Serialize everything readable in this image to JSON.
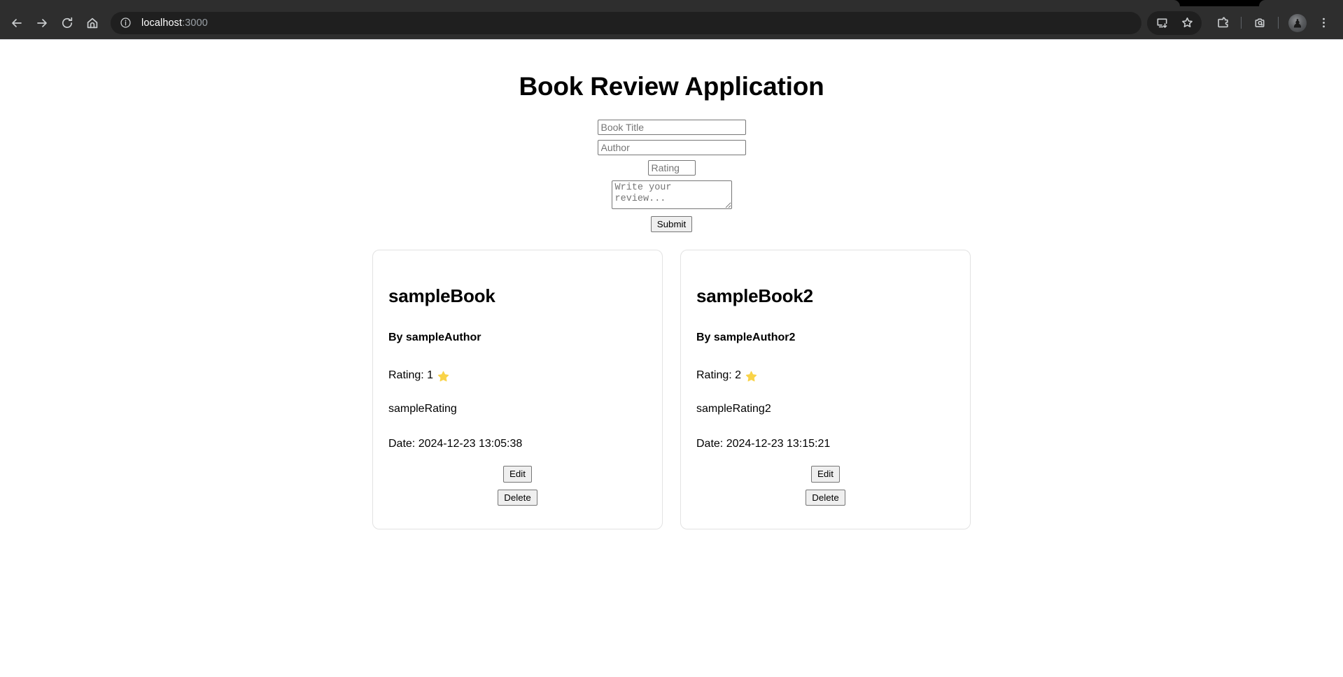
{
  "browser": {
    "nav": {
      "back_label": "Back",
      "forward_label": "Forward",
      "reload_label": "Reload",
      "home_label": "Home"
    },
    "omnibox": {
      "site_info_icon": "info-circle-icon",
      "url_host": "localhost",
      "url_port": ":3000",
      "full_url": "localhost:3000"
    },
    "toolbar_right": {
      "install_label": "Install page as app",
      "bookmark_label": "Bookmark this tab",
      "extensions_label": "Extensions",
      "lens_label": "Search with Google Lens",
      "profile_label": "Profile",
      "menu_label": "Customize and control Google Chrome",
      "avatar_glyph": "♟"
    }
  },
  "page": {
    "title": "Book Review Application",
    "form": {
      "title_placeholder": "Book Title",
      "title_value": "",
      "author_placeholder": "Author",
      "author_value": "",
      "rating_placeholder": "Rating",
      "rating_value": "",
      "review_placeholder": "Write your review...",
      "review_value": "",
      "submit_label": "Submit"
    },
    "buttons": {
      "edit_label": "Edit",
      "delete_label": "Delete"
    },
    "labels": {
      "by_prefix": "By ",
      "rating_prefix": "Rating: ",
      "date_prefix": "Date: "
    },
    "colors": {
      "star": "#F9D348",
      "card_border": "#E3E3E3",
      "chrome_toolbar": "#2E2E2E",
      "omnibox": "#1F1F1F"
    },
    "books": [
      {
        "title": "sampleBook",
        "author_line": "By sampleAuthor",
        "rating_line": "Rating: 1",
        "star_icon": "star-icon",
        "review": "sampleRating",
        "date_line": "Date: 2024-12-23 13:05:38"
      },
      {
        "title": "sampleBook2",
        "author_line": "By sampleAuthor2",
        "rating_line": "Rating: 2",
        "star_icon": "star-icon",
        "review": "sampleRating2",
        "date_line": "Date: 2024-12-23 13:15:21"
      }
    ]
  }
}
